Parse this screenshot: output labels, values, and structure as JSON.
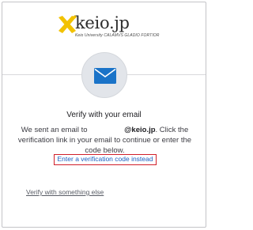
{
  "brand": {
    "name": "keio.jp",
    "tagline": "Keio University CALAMVS GLADIO FORTIOR",
    "logo_icon": "pen-cross-icon",
    "logo_color": "#f2c200"
  },
  "mail_icon": "envelope-icon",
  "title": "Verify with your email",
  "body": {
    "prefix": "We sent an email to",
    "domain": "@keio.jp",
    "suffix": ". Click the verification link in your email to continue or enter the code below."
  },
  "primary_link": "Enter a verification code instead",
  "secondary_link": "Verify with something else",
  "colors": {
    "link": "#1a5fc2",
    "highlight_box": "#d01f2a",
    "envelope": "#1a73c8"
  }
}
